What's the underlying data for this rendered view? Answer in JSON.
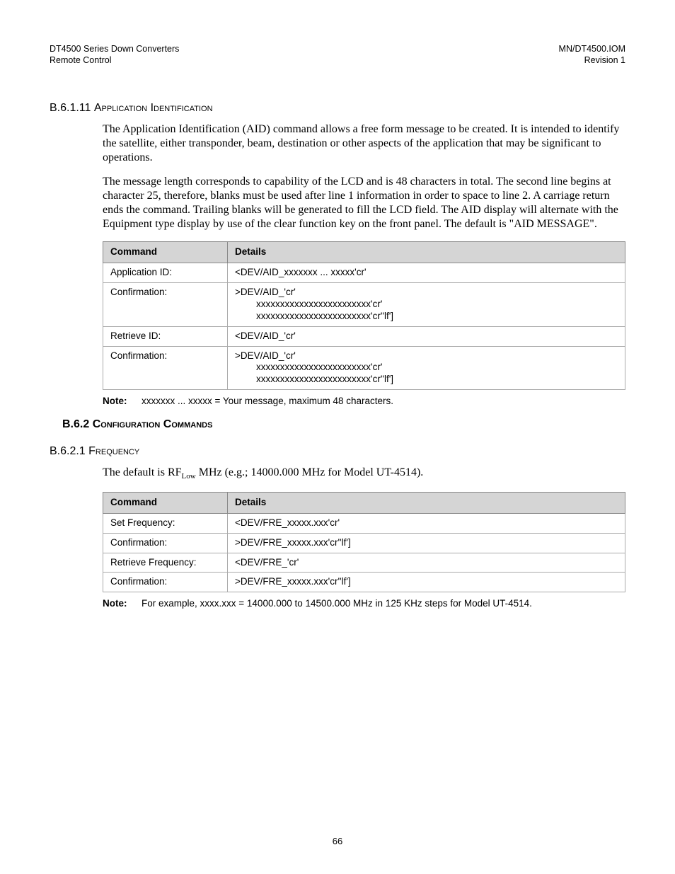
{
  "header": {
    "left_line1": "DT4500 Series Down Converters",
    "left_line2": "Remote Control",
    "right_line1": "MN/DT4500.IOM",
    "right_line2": "Revision 1"
  },
  "s1": {
    "num": "B.6.1.11 ",
    "title": "Application Identification",
    "para1": "The Application Identification (AID) command allows a free form message to be created. It is intended to identify the satellite, either transponder, beam, destination or other aspects of the application that may be significant to operations.",
    "para2": "The message length corresponds to capability of the LCD and is 48 characters in total. The second line begins at character 25, therefore, blanks must be used after line 1 information in order to space to line 2.  A carriage return ends the command.  Trailing blanks will be generated to fill the LCD field.  The AID display will alternate with the Equipment type display by use of the clear function key on the front panel.  The default is \"AID MESSAGE\".",
    "table": {
      "h1": "Command",
      "h2": "Details",
      "rows": [
        {
          "c": "Application ID:",
          "d": "<DEV/AID_xxxxxxx ... xxxxx'cr'"
        },
        {
          "c": "Confirmation:",
          "d": ">DEV/AID_'cr'\n        xxxxxxxxxxxxxxxxxxxxxxxx'cr'\n        xxxxxxxxxxxxxxxxxxxxxxxx'cr''lf']"
        },
        {
          "c": "Retrieve ID:",
          "d": "<DEV/AID_'cr'"
        },
        {
          "c": "Confirmation:",
          "d": ">DEV/AID_'cr'\n        xxxxxxxxxxxxxxxxxxxxxxxx'cr'\n        xxxxxxxxxxxxxxxxxxxxxxxx'cr''lf']"
        }
      ]
    },
    "note": "xxxxxxx ... xxxxx = Your message, maximum 48 characters."
  },
  "s2": {
    "num": "B.6.2 ",
    "title": "Configuration Commands"
  },
  "s3": {
    "num": "B.6.2.1 ",
    "title": "Frequency",
    "para_pre": "The default is RF",
    "para_sub": "Low",
    "para_post": " MHz (e.g.; 14000.000 MHz for Model UT-4514).",
    "table": {
      "h1": "Command",
      "h2": "Details",
      "rows": [
        {
          "c": "Set Frequency:",
          "d": "<DEV/FRE_xxxxx.xxx'cr'"
        },
        {
          "c": "Confirmation:",
          "d": ">DEV/FRE_xxxxx.xxx'cr''lf']"
        },
        {
          "c": "Retrieve Frequency:",
          "d": "<DEV/FRE_'cr'"
        },
        {
          "c": "Confirmation:",
          "d": ">DEV/FRE_xxxxx.xxx'cr''lf']"
        }
      ]
    },
    "note": "For example, xxxx.xxx = 14000.000 to 14500.000 MHz in 125 KHz steps for Model UT-4514."
  },
  "note_label": "Note:",
  "page_number": "66"
}
